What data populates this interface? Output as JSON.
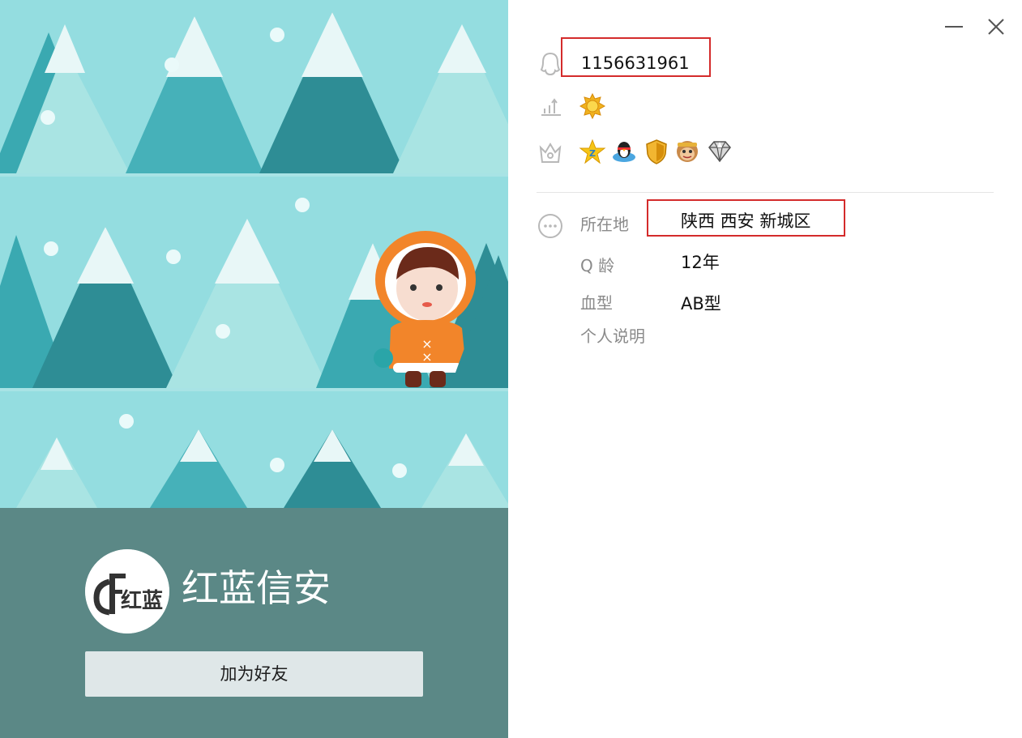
{
  "window": {
    "minimize_icon": "minimize-icon",
    "close_icon": "close-icon"
  },
  "profile": {
    "nickname": "红蓝信安",
    "avatar_text": "红蓝",
    "add_friend_label": "加为好友"
  },
  "account": {
    "qq_number": "1156631961",
    "level_icon": "sun-level-icon",
    "badges": [
      "qzone-star-icon",
      "penguin-icon",
      "shield-icon",
      "monkey-icon",
      "diamond-icon"
    ]
  },
  "details": {
    "location_label": "所在地",
    "location_value": "陕西 西安 新城区",
    "age_label": "Q 龄",
    "age_value": "12年",
    "blood_label": "血型",
    "blood_value": "AB型",
    "bio_label": "个人说明"
  },
  "colors": {
    "cover_bg": "#94dde0",
    "card_bg": "#5b8886",
    "highlight": "#d42b2b"
  }
}
